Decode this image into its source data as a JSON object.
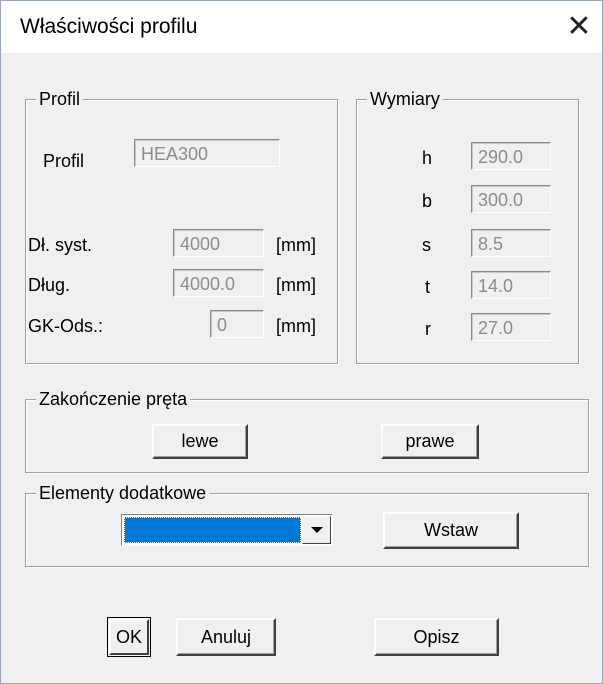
{
  "window": {
    "title": "Właściwości profilu",
    "close_glyph": "✕"
  },
  "profil_group": {
    "legend": "Profil",
    "profil_label": "Profil",
    "profil_value": "HEA300",
    "dl_syst_label": "Dł. syst.",
    "dl_syst_value": "4000",
    "dl_syst_unit": "[mm]",
    "dlug_label": "Dług.",
    "dlug_value": "4000.0",
    "dlug_unit": "[mm]",
    "gk_ods_label": "GK-Ods.:",
    "gk_ods_value": "0",
    "gk_ods_unit": "[mm]"
  },
  "wymiary_group": {
    "legend": "Wymiary",
    "rows": [
      {
        "label": "h",
        "value": "290.0"
      },
      {
        "label": "b",
        "value": "300.0"
      },
      {
        "label": "s",
        "value": "8.5"
      },
      {
        "label": "t",
        "value": "14.0"
      },
      {
        "label": "r",
        "value": "27.0"
      }
    ]
  },
  "zakonczenie_group": {
    "legend": "Zakończenie pręta",
    "left_button": "lewe",
    "right_button": "prawe"
  },
  "elementy_group": {
    "legend": "Elementy dodatkowe",
    "combo_value": "",
    "insert_button": "Wstaw"
  },
  "footer": {
    "ok_button": "OK",
    "cancel_button": "Anuluj",
    "describe_button": "Opisz"
  },
  "colors": {
    "dialog_bg": "#f0f0f0",
    "selection": "#0078d7",
    "disabled_text": "#8c8c8c"
  },
  "icons": {
    "close": "close-icon",
    "dropdown": "chevron-down-icon"
  }
}
